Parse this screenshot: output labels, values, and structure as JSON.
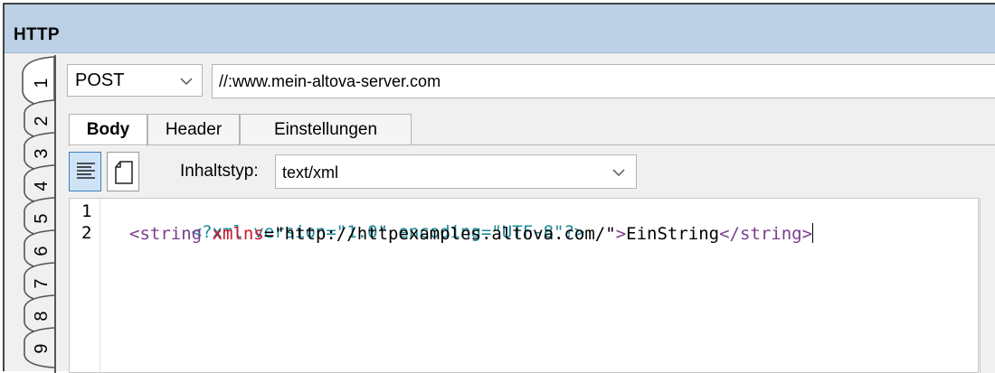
{
  "window": {
    "title": "HTTP"
  },
  "side_tabs": [
    "1",
    "2",
    "3",
    "4",
    "5",
    "6",
    "7",
    "8",
    "9"
  ],
  "request": {
    "method": "POST",
    "url": "//:www.mein-altova-server.com"
  },
  "tabs": [
    {
      "label": "Body",
      "active": true
    },
    {
      "label": "Header",
      "active": false
    },
    {
      "label": "Einstellungen",
      "active": false
    }
  ],
  "body_toolbar": {
    "content_type_label": "Inhaltstyp:",
    "content_type_value": "text/xml",
    "text_mode_icon": "text-lines-icon",
    "file_mode_icon": "document-icon"
  },
  "editor": {
    "line_numbers": [
      "1",
      "2"
    ],
    "line1": {
      "decl": "<?xml version=\"1.0\" encoding=\"UTF-8\"?>"
    },
    "line2": {
      "open_bracket": "<",
      "tag": "string",
      "attr_name": " xmlns",
      "eq": "=",
      "attr_value": "\"http://httpexamples.altova.com/\"",
      "close_bracket": ">",
      "text": "EinString",
      "end_open": "</",
      "end_tag": "string",
      "end_close": ">"
    }
  },
  "colors": {
    "titlebar": "#bcd0e6",
    "xml_decl": "#1b8a9a",
    "xml_tag": "#7a3e8c",
    "xml_attr": "#d0112b",
    "selected_button": "#cfe3f7"
  }
}
